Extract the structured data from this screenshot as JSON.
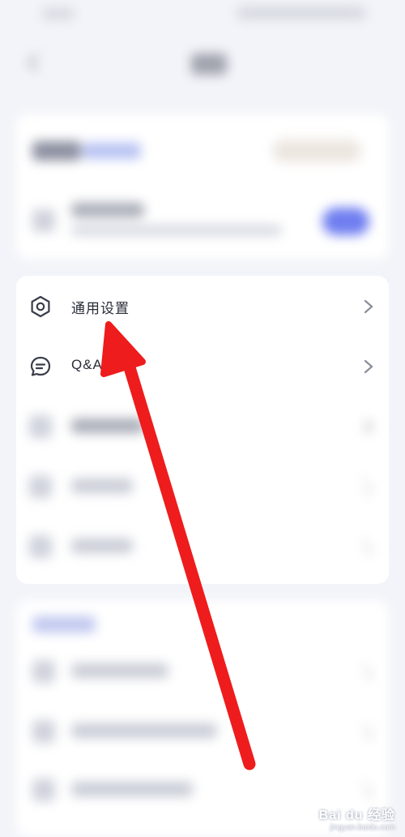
{
  "settings_list": [
    {
      "label": "通用设置",
      "icon": "gear-icon"
    },
    {
      "label": "Q&A",
      "icon": "chat-icon"
    }
  ],
  "watermark": {
    "text": "Bai du 经验",
    "sub": "jingyan.baidu.com"
  },
  "colors": {
    "background": "#f3f4f9",
    "card": "#ffffff",
    "toggle_accent": "#6f7ef0",
    "annotation_arrow": "#ee1c1c"
  }
}
